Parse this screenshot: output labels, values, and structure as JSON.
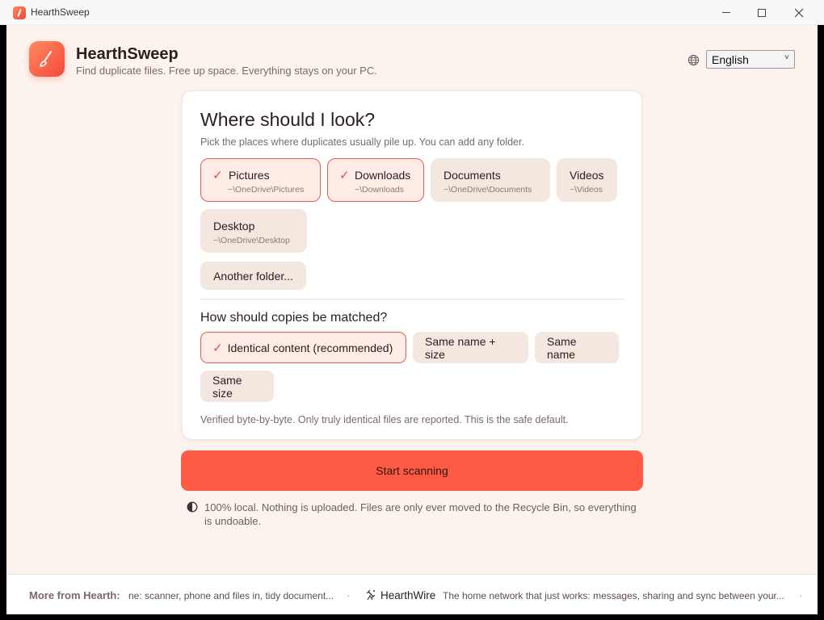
{
  "window": {
    "title": "HearthSweep",
    "minimize_icon": "minimize-icon",
    "maximize_icon": "maximize-icon",
    "close_icon": "close-icon"
  },
  "header": {
    "app_name": "HearthSweep",
    "tagline": "Find duplicate files. Free up space. Everything stays on your PC.",
    "logo_icon": "broom-icon",
    "language": {
      "icon": "globe-icon",
      "selected": "English"
    }
  },
  "locations": {
    "title": "Where should I look?",
    "subtitle": "Pick the places where duplicates usually pile up. You can add any folder.",
    "folders": [
      {
        "label": "Pictures",
        "path": "~\\OneDrive\\Pictures",
        "selected": true
      },
      {
        "label": "Downloads",
        "path": "~\\Downloads",
        "selected": true
      },
      {
        "label": "Documents",
        "path": "~\\OneDrive\\Documents",
        "selected": false
      },
      {
        "label": "Videos",
        "path": "~\\Videos",
        "selected": false
      },
      {
        "label": "Desktop",
        "path": "~\\OneDrive\\Desktop",
        "selected": false
      }
    ],
    "check_mark": "✓",
    "add_folder_label": "Another folder..."
  },
  "matching": {
    "title": "How should copies be matched?",
    "options": [
      {
        "label": "Identical content (recommended)",
        "selected": true
      },
      {
        "label": "Same name + size",
        "selected": false
      },
      {
        "label": "Same name",
        "selected": false
      },
      {
        "label": "Same size",
        "selected": false
      }
    ],
    "note": "Verified byte-by-byte. Only truly identical files are reported. This is the safe default."
  },
  "actions": {
    "start_label": "Start scanning"
  },
  "privacy": {
    "icon": "shield-icon",
    "text": "100% local. Nothing is uploaded. Files are only ever moved to the Recycle Bin, so everything is undoable."
  },
  "footer": {
    "label": "More from Hearth:",
    "item1_text": "ne: scanner, phone and files in, tidy document...",
    "separator": "·",
    "item2_name": "HearthWire",
    "item2_icon": "satellite-icon",
    "item2_desc": "The home network that just works: messages, sharing and sync between your..."
  },
  "colors": {
    "accent": "#ff5a45",
    "background": "#fdf3ee",
    "chip": "#f3e7df",
    "chip_selected_border": "#ec5a4b"
  }
}
